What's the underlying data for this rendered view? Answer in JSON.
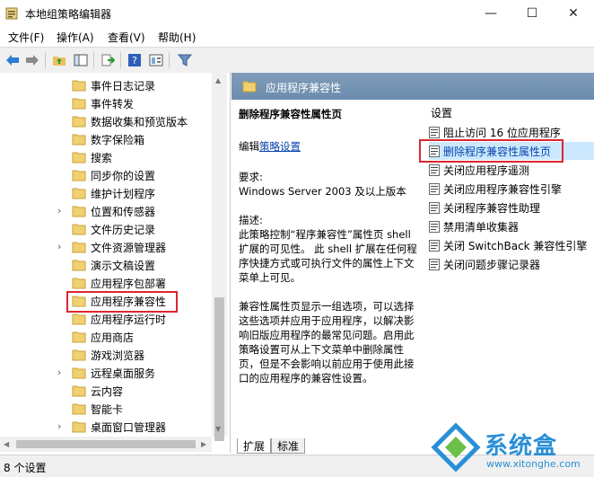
{
  "window": {
    "title": "本地组策略编辑器"
  },
  "menu": [
    "文件(F)",
    "操作(A)",
    "查看(V)",
    "帮助(H)"
  ],
  "tree": {
    "items": [
      {
        "label": "事件日志记录",
        "expandable": false
      },
      {
        "label": "事件转发",
        "expandable": false
      },
      {
        "label": "数据收集和预览版本",
        "expandable": false
      },
      {
        "label": "数字保险箱",
        "expandable": false
      },
      {
        "label": "搜索",
        "expandable": false
      },
      {
        "label": "同步你的设置",
        "expandable": false
      },
      {
        "label": "维护计划程序",
        "expandable": false
      },
      {
        "label": "位置和传感器",
        "expandable": true
      },
      {
        "label": "文件历史记录",
        "expandable": false
      },
      {
        "label": "文件资源管理器",
        "expandable": true
      },
      {
        "label": "演示文稿设置",
        "expandable": false
      },
      {
        "label": "应用程序包部署",
        "expandable": false
      },
      {
        "label": "应用程序兼容性",
        "expandable": false,
        "selected": true
      },
      {
        "label": "应用程序运行时",
        "expandable": false
      },
      {
        "label": "应用商店",
        "expandable": false
      },
      {
        "label": "游戏浏览器",
        "expandable": false
      },
      {
        "label": "远程桌面服务",
        "expandable": true
      },
      {
        "label": "云内容",
        "expandable": false
      },
      {
        "label": "智能卡",
        "expandable": false
      },
      {
        "label": "桌面窗口管理器",
        "expandable": true
      }
    ]
  },
  "right": {
    "header": "应用程序兼容性",
    "policy_title": "删除程序兼容性属性页",
    "edit_prefix": "编辑",
    "edit_link": "策略设置",
    "req_label": "要求:",
    "req_value": "Windows Server 2003 及以上版本",
    "desc_label": "描述:",
    "desc_p1": "此策略控制“程序兼容性”属性页 shell 扩展的可见性。 此 shell 扩展在任何程序快捷方式或可执行文件的属性上下文菜单上可见。",
    "desc_p2": "兼容性属性页显示一组选项，可以选择这些选项并应用于应用程序，以解决影响旧版应用程序的最常见问题。启用此策略设置可从上下文菜单中删除属性页，但是不会影响以前应用于使用此接口的应用程序的兼容性设置。",
    "settings_header": "设置",
    "settings": [
      {
        "label": "阻止访问 16 位应用程序"
      },
      {
        "label": "删除程序兼容性属性页",
        "selected": true
      },
      {
        "label": "关闭应用程序遥测"
      },
      {
        "label": "关闭应用程序兼容性引擎"
      },
      {
        "label": "关闭程序兼容性助理"
      },
      {
        "label": "禁用清单收集器"
      },
      {
        "label": "关闭 SwitchBack 兼容性引擎"
      },
      {
        "label": "关闭问题步骤记录器"
      }
    ]
  },
  "tabs": [
    "扩展",
    "标准"
  ],
  "status": "8 个设置",
  "watermark": {
    "name": "系统盒",
    "url": "www.xitonghe.com"
  },
  "colors": {
    "header": "#6d8cae",
    "highlight": "#d9282f",
    "selected": "#cce8ff",
    "link": "#0645ad"
  }
}
